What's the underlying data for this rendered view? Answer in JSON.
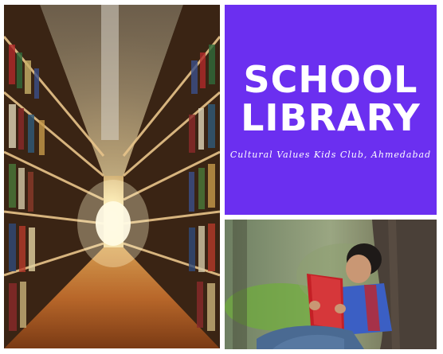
{
  "poster": {
    "title_line1": "SCHOOL",
    "title_line2": "LIBRARY",
    "subtitle": "Cultural Values Kids Club, Ahmedabad"
  },
  "colors": {
    "title_panel_bg": "#6b2ff0",
    "text": "#ffffff",
    "page_bg": "#ffffff"
  },
  "images": {
    "aisle": "library-aisle-photo",
    "boy": "boy-reading-book-photo"
  }
}
